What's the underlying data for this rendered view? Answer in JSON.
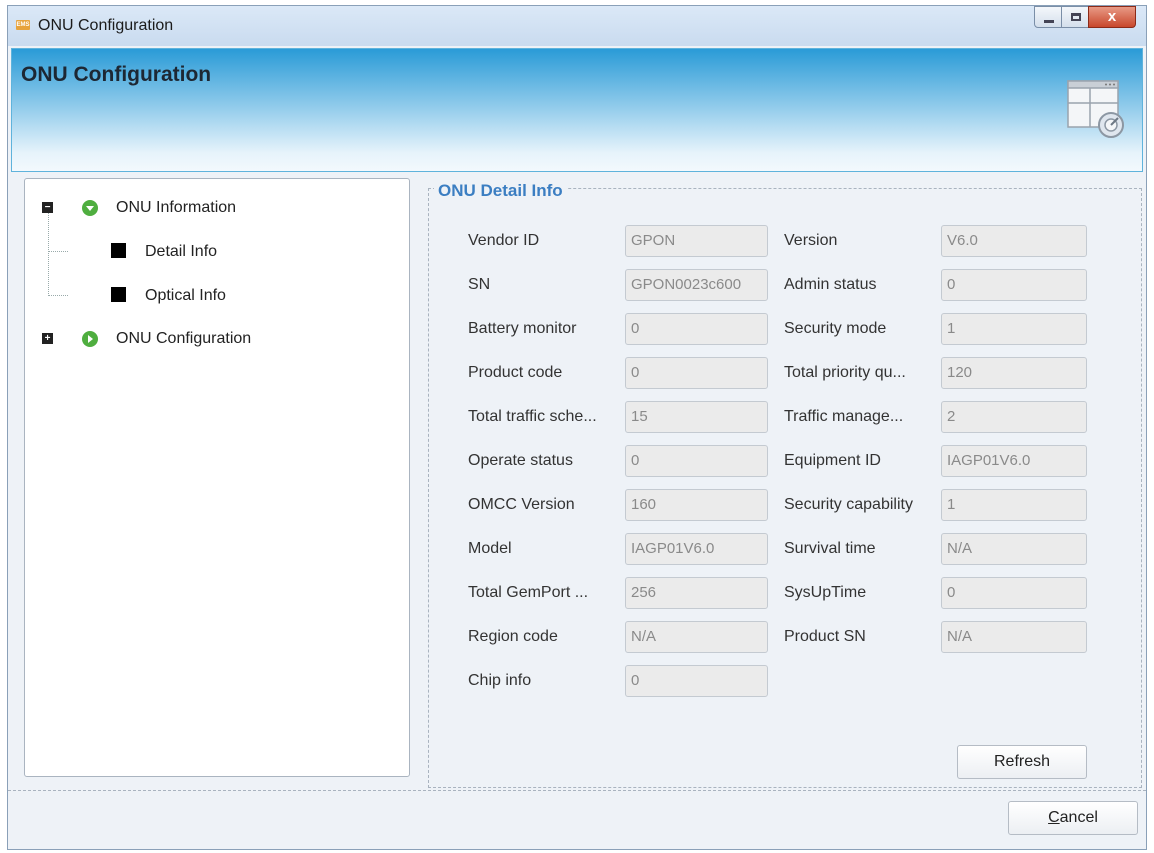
{
  "window": {
    "title": "ONU Configuration",
    "app_icon_text": "EMS"
  },
  "banner": {
    "title": "ONU Configuration"
  },
  "tree": {
    "root1": {
      "label": "ONU Information",
      "children": [
        "Detail Info",
        "Optical Info"
      ]
    },
    "root2": {
      "label": "ONU Configuration"
    }
  },
  "detail": {
    "group_title": "ONU Detail Info",
    "left_fields": [
      {
        "label": "Vendor ID",
        "value": "GPON"
      },
      {
        "label": "SN",
        "value": "GPON0023c600"
      },
      {
        "label": "Battery monitor",
        "value": "0"
      },
      {
        "label": "Product code",
        "value": "0"
      },
      {
        "label": "Total traffic sche...",
        "value": "15"
      },
      {
        "label": "Operate status",
        "value": "0"
      },
      {
        "label": "OMCC Version",
        "value": "160"
      },
      {
        "label": "Model",
        "value": "IAGP01V6.0"
      },
      {
        "label": "Total GemPort ...",
        "value": "256"
      },
      {
        "label": "Region code",
        "value": "N/A"
      },
      {
        "label": "Chip info",
        "value": "0"
      }
    ],
    "right_fields": [
      {
        "label": "Version",
        "value": "V6.0"
      },
      {
        "label": "Admin status",
        "value": "0"
      },
      {
        "label": "Security mode",
        "value": "1"
      },
      {
        "label": "Total priority qu...",
        "value": "120"
      },
      {
        "label": "Traffic manage...",
        "value": "2"
      },
      {
        "label": "Equipment ID",
        "value": "IAGP01V6.0"
      },
      {
        "label": "Security capability",
        "value": "1"
      },
      {
        "label": "Survival time",
        "value": "N/A"
      },
      {
        "label": "SysUpTime",
        "value": "0"
      },
      {
        "label": "Product SN",
        "value": "N/A"
      }
    ],
    "refresh_label": "Refresh"
  },
  "footer": {
    "cancel_first": "C",
    "cancel_rest": "ancel"
  }
}
